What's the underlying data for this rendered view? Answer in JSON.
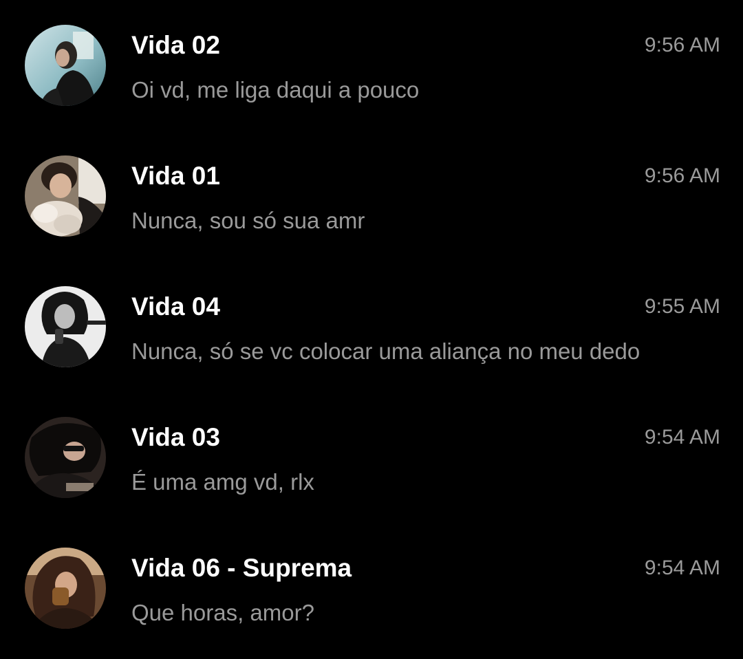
{
  "chats": [
    {
      "name": "Vida 02",
      "time": "9:56 AM",
      "preview": "Oi vd, me liga daqui a pouco",
      "avatar_icon": "avatar-photo-icon"
    },
    {
      "name": "Vida 01",
      "time": "9:56 AM",
      "preview": "Nunca, sou só sua amr",
      "avatar_icon": "avatar-photo-icon"
    },
    {
      "name": "Vida 04",
      "time": "9:55 AM",
      "preview": "Nunca, só se vc colocar uma aliança no meu dedo",
      "avatar_icon": "avatar-photo-icon"
    },
    {
      "name": "Vida 03",
      "time": "9:54 AM",
      "preview": "É uma amg vd, rlx",
      "avatar_icon": "avatar-photo-icon"
    },
    {
      "name": "Vida 06 - Suprema",
      "time": "9:54 AM",
      "preview": "Que horas, amor?",
      "avatar_icon": "avatar-photo-icon"
    }
  ],
  "colors": {
    "background": "#000000",
    "name_text": "#ffffff",
    "secondary_text": "#9a9a9a"
  }
}
